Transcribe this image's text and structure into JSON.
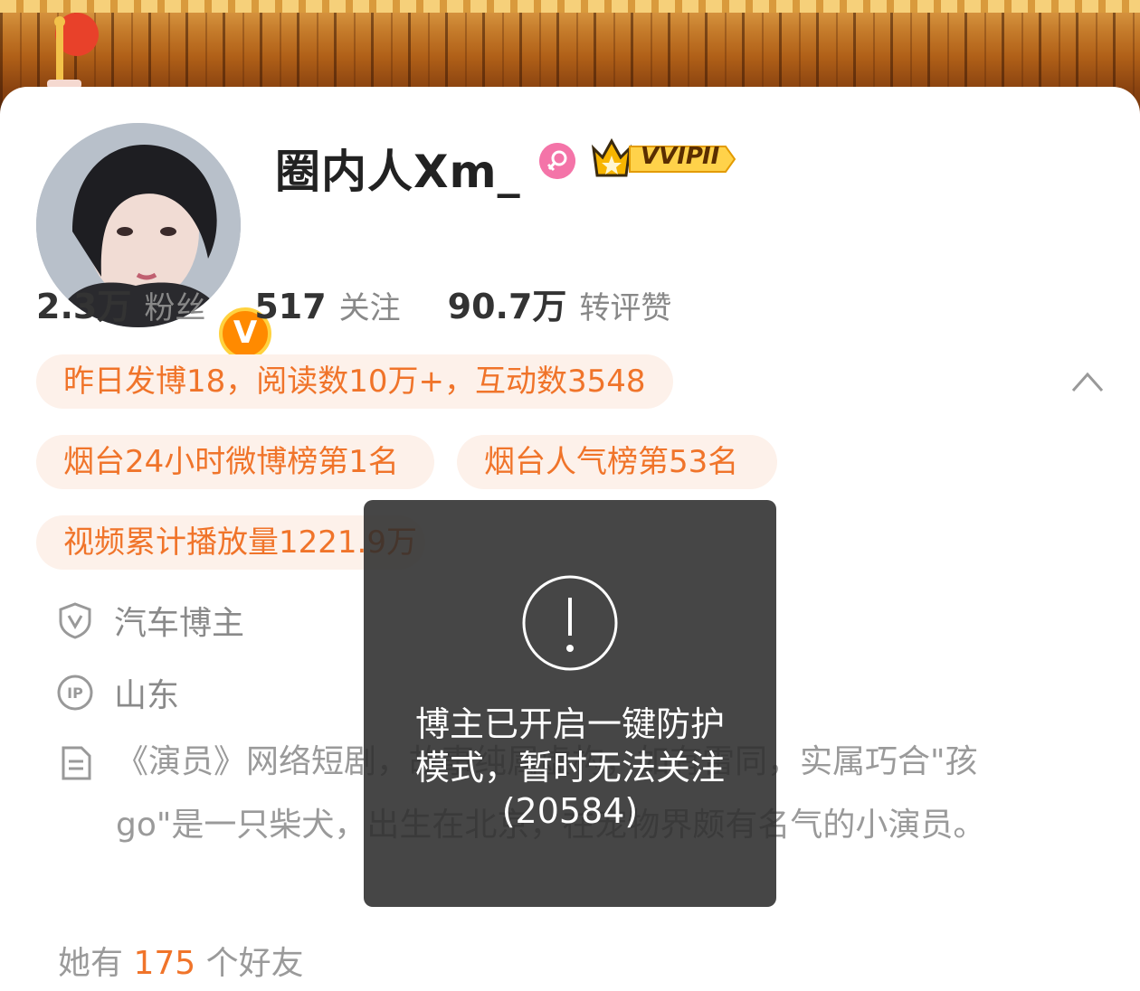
{
  "profile": {
    "username": "圈内人Xm_",
    "vip_label": "VVIP",
    "vip_level": "II",
    "verified_badge": "V"
  },
  "stats": [
    {
      "value": "2.3万",
      "label": "粉丝"
    },
    {
      "value": "517",
      "label": "关注"
    },
    {
      "value": "90.7万",
      "label": "转评赞"
    }
  ],
  "chips": {
    "yesterday": "昨日发博18，阅读数10万+，互动数3548",
    "rank_24h": "烟台24小时微博榜第1名",
    "rank_popular": "烟台人气榜第53名",
    "video_plays": "视频累计播放量1221.9万"
  },
  "info": {
    "category": "汽车博主",
    "ip": "山东",
    "bio": "《演员》网络短剧，故事纯属虚构，如有雷同，实属巧合\"孩go\"是一只柴犬，出生在北京，在宠物界颇有名气的小演员。"
  },
  "friends": {
    "prefix": "她有",
    "count": "175",
    "suffix": "个好友"
  },
  "toast": {
    "line1": "博主已开启一键防护",
    "line2": "模式，暂时无法关注",
    "line3": "(20584)"
  },
  "icons": {
    "expand": "chevron-up-icon",
    "category": "shield-v-icon",
    "ip": "ip-icon",
    "bio": "document-icon",
    "toast": "exclamation-circle-icon",
    "gender": "female-icon"
  },
  "colors": {
    "accent": "#f0742a",
    "chip_bg": "#fdf1ea",
    "female": "#f474a8",
    "vip_gold": "#f7b500"
  }
}
